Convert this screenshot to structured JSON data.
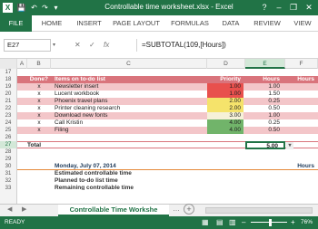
{
  "window": {
    "title": "Controllable time worksheet.xlsx - Excel",
    "help": "?",
    "minimize": "–",
    "restore": "❐",
    "close": "✕"
  },
  "quick_access": {
    "save": "💾",
    "undo": "↶",
    "redo": "↷",
    "customize": "▾"
  },
  "ribbon": {
    "tabs": [
      "FILE",
      "HOME",
      "INSERT",
      "PAGE LAYOUT",
      "FORMULAS",
      "DATA",
      "REVIEW",
      "VIEW"
    ]
  },
  "formula_bar": {
    "name_box": "E27",
    "cancel": "✕",
    "enter": "✓",
    "fx": "fx",
    "formula": "=SUBTOTAL(109,[Hours])"
  },
  "columns": [
    "A",
    "B",
    "C",
    "D",
    "E",
    "F"
  ],
  "rows": {
    "numbers": [
      "17",
      "18",
      "19",
      "20",
      "21",
      "22",
      "23",
      "24",
      "25",
      "26",
      "27",
      "28",
      "29",
      "30",
      "31",
      "32",
      "33"
    ],
    "table_header": {
      "done": "Done?",
      "items": "Items on to-do list",
      "priority": "Priority",
      "hours": "Hours",
      "hours2": "Hours"
    },
    "items": [
      {
        "done": "x",
        "item": "Newsletter insert",
        "priority": "1.00",
        "hours": "1.00"
      },
      {
        "done": "x",
        "item": "Lucent workbook",
        "priority": "1.00",
        "hours": "1.50"
      },
      {
        "done": "x",
        "item": "Phoenix travel plans",
        "priority": "2.00",
        "hours": "0.25"
      },
      {
        "done": "x",
        "item": "Printer cleaning research",
        "priority": "2.00",
        "hours": "0.50"
      },
      {
        "done": "x",
        "item": "Download new fonts",
        "priority": "3.00",
        "hours": "1.00"
      },
      {
        "done": "x",
        "item": "Call Kristin",
        "priority": "4.00",
        "hours": "0.25"
      },
      {
        "done": "x",
        "item": "Filing",
        "priority": "4.00",
        "hours": "0.50"
      }
    ],
    "total_label": "Total",
    "total_value": "5.00",
    "total_dropdown": "▾",
    "date": "Monday, July 07, 2014",
    "hours_label": "Hours",
    "summary": [
      "Estimated controllable time",
      "Planned to-do list time",
      "Remaining controllable time"
    ]
  },
  "sheet": {
    "prev": "◀",
    "next": "▶",
    "tab": "Controllable Time Workshe",
    "more": "…",
    "add": "+"
  },
  "status": {
    "ready": "READY",
    "zoom": "76%",
    "zoom_minus": "–",
    "zoom_plus": "+"
  },
  "colors": {
    "excel_green": "#217346",
    "header_row": "#d9747c",
    "row_fill": "#f3c6c9",
    "priority_red": "#e8504d",
    "priority_yellow": "#f5e36b",
    "priority_green": "#71b46a",
    "date_rule": "#e5893a"
  }
}
